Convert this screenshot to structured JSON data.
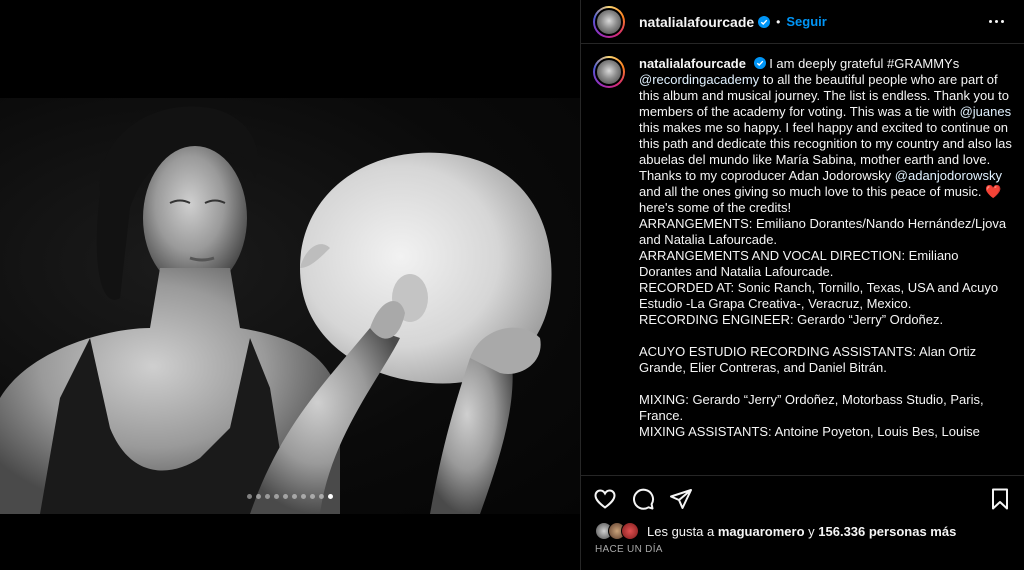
{
  "post": {
    "username": "natalialafourcade",
    "follow_label": "Seguir",
    "separator": "•",
    "carousel": {
      "count": 10,
      "active_index": 9
    }
  },
  "caption": {
    "username": "natalialafourcade",
    "parts": {
      "p1": "I am deeply grateful #GRAMMYs",
      "mention1": "@recordingacademy",
      "p2": " to all the beautiful people who are part of this album and musical journey. The list is endless. Thank you to members of the academy for voting. This was a tie with ",
      "mention2": "@juanes",
      "p3": " this makes me so happy. I feel happy and excited to continue on this path and dedicate this recognition to my country and also las abuelas del mundo like María Sabina, mother earth and love. Thanks to my coproducer Adan Jodorowsky ",
      "mention3": "@adanjodorowsky",
      "p4": " and all the ones giving so much love to this peace of music. ",
      "heart": "❤️",
      "p5": " here's some of the credits!"
    },
    "credits": [
      "ARRANGEMENTS: Emiliano Dorantes/Nando Hernández/Ljova and Natalia Lafourcade.",
      "ARRANGEMENTS AND VOCAL DIRECTION: Emiliano Dorantes and Natalia Lafourcade.",
      "RECORDED AT: Sonic Ranch, Tornillo, Texas, USA and Acuyo Estudio -La Grapa Creativa-, Veracruz, Mexico.",
      "RECORDING ENGINEER: Gerardo “Jerry” Ordoñez.",
      "",
      "ACUYO ESTUDIO RECORDING ASSISTANTS: Alan Ortiz Grande, Elier Contreras, and Daniel Bitrán.",
      "",
      "MIXING: Gerardo “Jerry” Ordoñez, Motorbass Studio, Paris, France.",
      "MIXING ASSISTANTS: Antoine Poyeton, Louis Bes, Louise"
    ]
  },
  "actions": {
    "like": "heart-icon",
    "comment": "comment-icon",
    "share": "paper-plane-icon",
    "save": "bookmark-icon"
  },
  "likes": {
    "prefix": "Les gusta a ",
    "user": "maguaromero",
    "middle": " y ",
    "count": "156.336 personas más"
  },
  "timestamp": "HACE UN DÍA",
  "colors": {
    "link_blue": "#0095f6",
    "background": "#000000",
    "verified": "#0095f6",
    "heart_red": "#ed4956"
  }
}
